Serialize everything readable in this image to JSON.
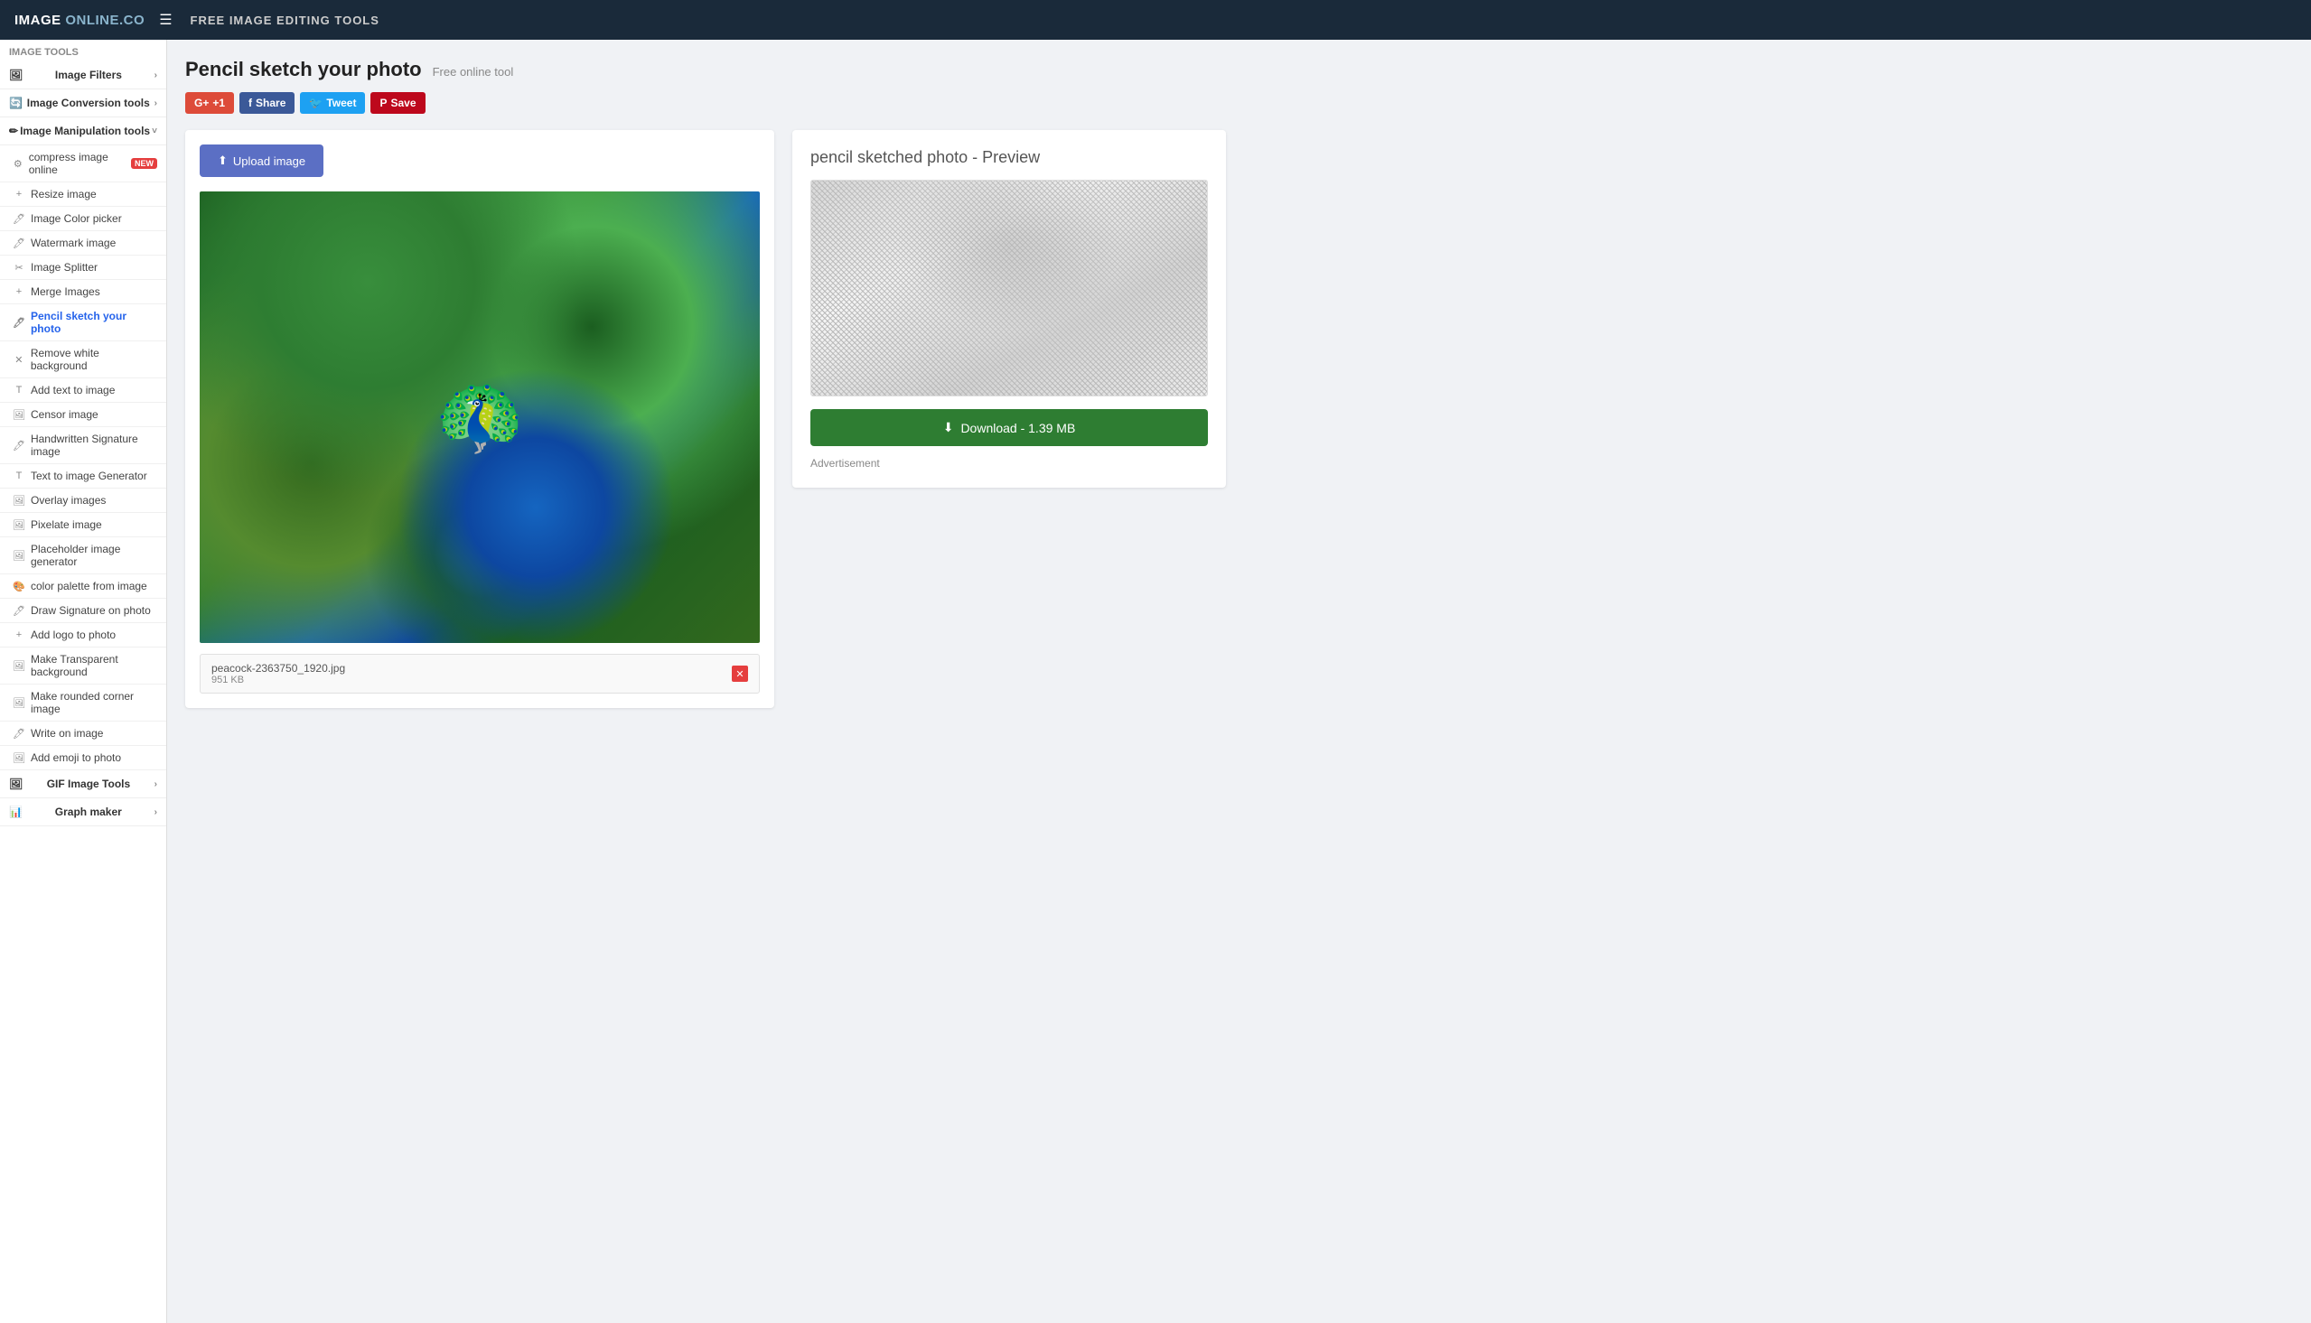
{
  "header": {
    "logo_bold": "IMAGE",
    "logo_light": " ONLINE.CO",
    "menu_icon": "☰",
    "title": "FREE IMAGE EDITING TOOLS"
  },
  "sidebar": {
    "section_label": "Image Tools",
    "groups": [
      {
        "id": "image-filters",
        "label": "Image Filters",
        "expanded": false,
        "icon": "🖼"
      },
      {
        "id": "image-conversion",
        "label": "Image Conversion tools",
        "expanded": false,
        "icon": "🔄"
      },
      {
        "id": "image-manipulation",
        "label": "Image Manipulation tools",
        "expanded": true,
        "icon": "✏"
      }
    ],
    "manipulation_items": [
      {
        "id": "compress-image",
        "label": "compress image online",
        "badge": "NEW",
        "icon": "⚙"
      },
      {
        "id": "resize-image",
        "label": "Resize image",
        "icon": "+"
      },
      {
        "id": "image-color-picker",
        "label": "Image Color picker",
        "icon": "🖊"
      },
      {
        "id": "watermark-image",
        "label": "Watermark image",
        "icon": "🖊"
      },
      {
        "id": "image-splitter",
        "label": "Image Splitter",
        "icon": "✂"
      },
      {
        "id": "merge-images",
        "label": "Merge Images",
        "icon": "+"
      },
      {
        "id": "pencil-sketch",
        "label": "Pencil sketch your photo",
        "icon": "🖊",
        "active": true
      },
      {
        "id": "remove-white-bg",
        "label": "Remove white background",
        "icon": "✕"
      },
      {
        "id": "add-text-to-image",
        "label": "Add text to image",
        "icon": "T"
      },
      {
        "id": "censor-image",
        "label": "Censor image",
        "icon": "🖼"
      },
      {
        "id": "handwritten-signature",
        "label": "Handwritten Signature image",
        "icon": "🖊"
      },
      {
        "id": "text-to-image",
        "label": "Text to image Generator",
        "icon": "T"
      },
      {
        "id": "overlay-images",
        "label": "Overlay images",
        "icon": "🖼"
      },
      {
        "id": "pixelate-image",
        "label": "Pixelate image",
        "icon": "🖼"
      },
      {
        "id": "placeholder-image",
        "label": "Placeholder image generator",
        "icon": "🖼"
      },
      {
        "id": "color-palette",
        "label": "color palette from image",
        "icon": "🎨"
      },
      {
        "id": "draw-signature",
        "label": "Draw Signature on photo",
        "icon": "🖊"
      },
      {
        "id": "add-logo",
        "label": "Add logo to photo",
        "icon": "+"
      },
      {
        "id": "make-transparent",
        "label": "Make Transparent background",
        "icon": "🖼"
      },
      {
        "id": "rounded-corner",
        "label": "Make rounded corner image",
        "icon": "🖼"
      },
      {
        "id": "write-on-image",
        "label": "Write on image",
        "icon": "🖊"
      },
      {
        "id": "add-emoji",
        "label": "Add emoji to photo",
        "icon": "🖼"
      }
    ],
    "gif_tools": {
      "label": "GIF Image Tools",
      "icon": "🖼"
    },
    "graph_maker": {
      "label": "Graph maker",
      "icon": "📊"
    }
  },
  "page": {
    "title": "Pencil sketch your photo",
    "subtitle": "Free online tool",
    "social_buttons": [
      {
        "id": "gplus",
        "label": "+1",
        "class": "btn-gplus"
      },
      {
        "id": "facebook",
        "label": "Share",
        "class": "btn-facebook"
      },
      {
        "id": "twitter",
        "label": "Tweet",
        "class": "btn-twitter"
      },
      {
        "id": "pinterest",
        "label": "Save",
        "class": "btn-pinterest"
      }
    ],
    "upload_button": "Upload image",
    "preview_title": "pencil sketched photo - Preview",
    "download_button": "Download - 1.39 MB",
    "advertisement_label": "Advertisement",
    "file": {
      "name": "peacock-2363750_1920.jpg",
      "size": "951 KB"
    }
  }
}
